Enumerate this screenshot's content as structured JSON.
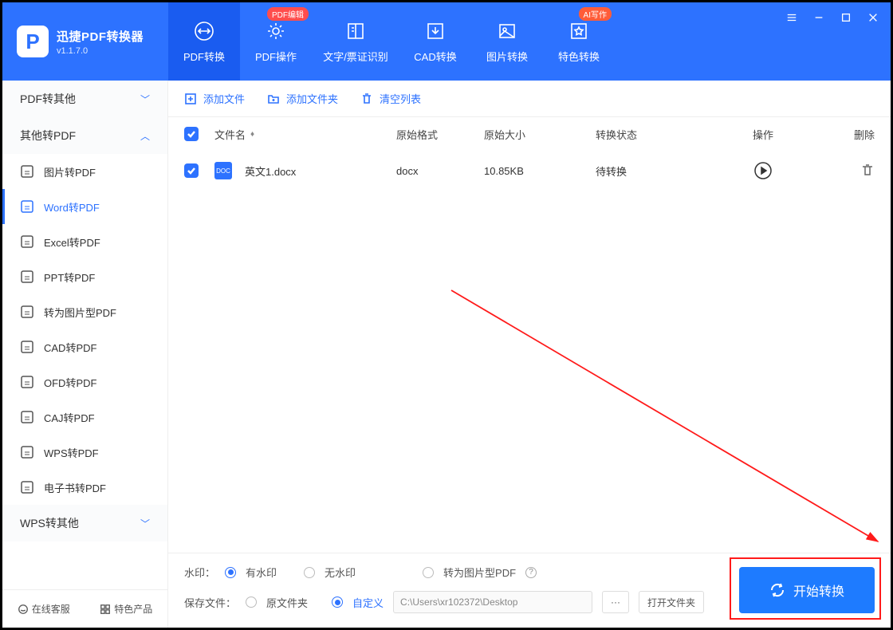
{
  "brand": {
    "title": "迅捷PDF转换器",
    "version": "v1.1.7.0"
  },
  "tabs": [
    {
      "label": "PDF转换",
      "active": true,
      "icon": "swap"
    },
    {
      "label": "PDF操作",
      "icon": "gear",
      "tag": "PDF编辑"
    },
    {
      "label": "文字/票证识别",
      "icon": "book",
      "wide": true
    },
    {
      "label": "CAD转换",
      "icon": "down"
    },
    {
      "label": "图片转换",
      "icon": "image"
    },
    {
      "label": "特色转换",
      "icon": "star",
      "tag": "AI写作",
      "tagClass": "orange"
    }
  ],
  "sidebar": {
    "sections": [
      {
        "label": "PDF转其他",
        "expanded": false
      },
      {
        "label": "其他转PDF",
        "expanded": true,
        "items": [
          {
            "label": "图片转PDF",
            "icon": "img"
          },
          {
            "label": "Word转PDF",
            "icon": "word",
            "active": true
          },
          {
            "label": "Excel转PDF",
            "icon": "excel"
          },
          {
            "label": "PPT转PDF",
            "icon": "ppt"
          },
          {
            "label": "转为图片型PDF",
            "icon": "img"
          },
          {
            "label": "CAD转PDF",
            "icon": "cad"
          },
          {
            "label": "OFD转PDF",
            "icon": "ofd"
          },
          {
            "label": "CAJ转PDF",
            "icon": "caj"
          },
          {
            "label": "WPS转PDF",
            "icon": "wps"
          },
          {
            "label": "电子书转PDF",
            "icon": "ebook"
          }
        ]
      },
      {
        "label": "WPS转其他",
        "expanded": false
      }
    ],
    "footer": {
      "service": "在线客服",
      "featured": "特色产品"
    }
  },
  "toolbar": {
    "addFile": "添加文件",
    "addFolder": "添加文件夹",
    "clear": "清空列表"
  },
  "table": {
    "head": {
      "name": "文件名",
      "fmt": "原始格式",
      "size": "原始大小",
      "status": "转换状态",
      "op": "操作",
      "del": "删除"
    },
    "rows": [
      {
        "name": "英文1.docx",
        "fmt": "docx",
        "size": "10.85KB",
        "status": "待转换"
      }
    ]
  },
  "bottom": {
    "watermarkLabel": "水印：",
    "wmYes": "有水印",
    "wmNo": "无水印",
    "imgPdf": "转为图片型PDF",
    "saveLabel": "保存文件：",
    "origFolder": "原文件夹",
    "custom": "自定义",
    "path": "C:\\Users\\xr102372\\Desktop",
    "browse": "···",
    "openFolder": "打开文件夹",
    "start": "开始转换"
  }
}
